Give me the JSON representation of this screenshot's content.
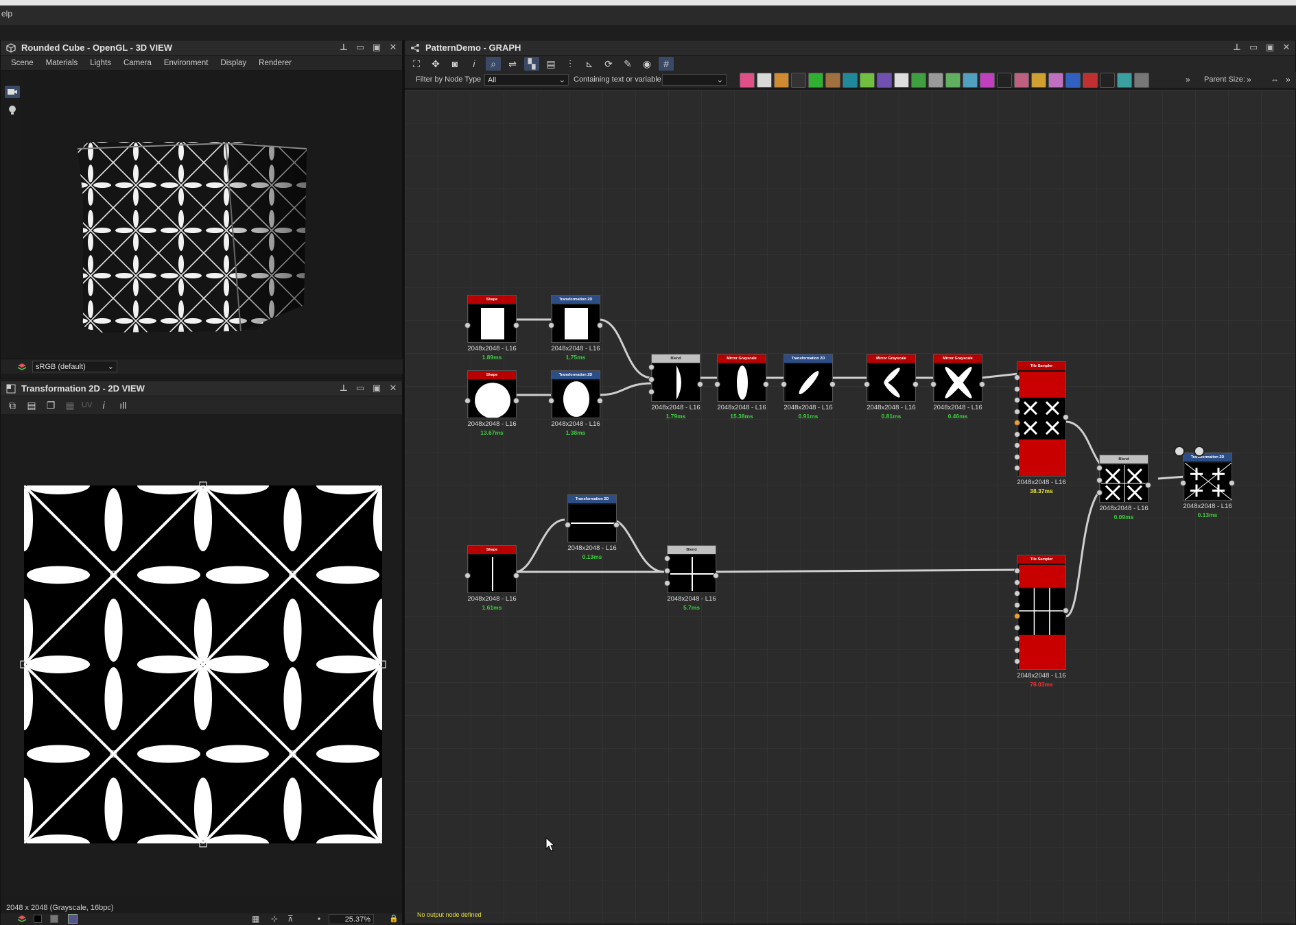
{
  "app": {
    "menubar_fragment": "elp"
  },
  "view3d": {
    "title": "Rounded Cube - OpenGL - 3D VIEW",
    "menu": [
      "Scene",
      "Materials",
      "Lights",
      "Camera",
      "Environment",
      "Display",
      "Renderer"
    ],
    "colorspace": "sRGB (default)"
  },
  "view2d": {
    "title": "Transformation 2D - 2D VIEW",
    "toolbar_uv": "UV",
    "status": "2048 x 2048 (Grayscale, 16bpc)",
    "zoom": "25.37%"
  },
  "graph": {
    "title": "PatternDemo - GRAPH",
    "filter_label": "Filter by Node Type",
    "filter_value": "All",
    "containing_label": "Containing text or variable",
    "containing_value": "",
    "parent_size_label": "Parent Size:",
    "bottom_status": "No output node defined",
    "nodes": [
      {
        "id": "shape1",
        "title": "Shape",
        "size": "2048x2048 - L16",
        "time": "1.89ms"
      },
      {
        "id": "trans1",
        "title": "Transformation 2D",
        "size": "2048x2048 - L16",
        "time": "1.75ms"
      },
      {
        "id": "shape2",
        "title": "Shape",
        "size": "2048x2048 - L16",
        "time": "13.67ms"
      },
      {
        "id": "trans2",
        "title": "Transformation 2D",
        "size": "2048x2048 - L16",
        "time": "1.38ms"
      },
      {
        "id": "blend1",
        "title": "Blend",
        "size": "2048x2048 - L16",
        "time": "1.79ms"
      },
      {
        "id": "mirror1",
        "title": "Mirror Grayscale",
        "size": "2048x2048 - L16",
        "time": "15.38ms"
      },
      {
        "id": "trans3",
        "title": "Transformation 2D",
        "size": "2048x2048 - L16",
        "time": "0.91ms"
      },
      {
        "id": "mirror2",
        "title": "Mirror Grayscale",
        "size": "2048x2048 - L16",
        "time": "0.81ms"
      },
      {
        "id": "mirror3",
        "title": "Mirror Grayscale",
        "size": "2048x2048 - L16",
        "time": "0.46ms"
      },
      {
        "id": "tile1",
        "title": "Tile Sampler",
        "size": "2048x2048 - L16",
        "time": "38.37ms"
      },
      {
        "id": "blend3",
        "title": "Blend",
        "size": "2048x2048 - L16",
        "time": "0.09ms"
      },
      {
        "id": "trans5",
        "title": "Transformation 2D",
        "size": "2048x2048 - L16",
        "time": "0.13ms"
      },
      {
        "id": "trans4",
        "title": "Transformation 2D",
        "size": "2048x2048 - L16",
        "time": "0.13ms"
      },
      {
        "id": "shape3",
        "title": "Shape",
        "size": "2048x2048 - L16",
        "time": "1.61ms"
      },
      {
        "id": "blend2",
        "title": "Blend",
        "size": "2048x2048 - L16",
        "time": "5.7ms"
      },
      {
        "id": "tile2",
        "title": "Tile Sampler",
        "size": "2048x2048 - L16",
        "time": "78.03ms"
      }
    ]
  },
  "colors": {
    "time_ok": "#3bd13b",
    "time_warn": "#e8e83a",
    "time_slow": "#ff3030",
    "node_red": "#b80000",
    "node_blue": "#2d4d86",
    "node_grey": "#c0c0c0"
  }
}
